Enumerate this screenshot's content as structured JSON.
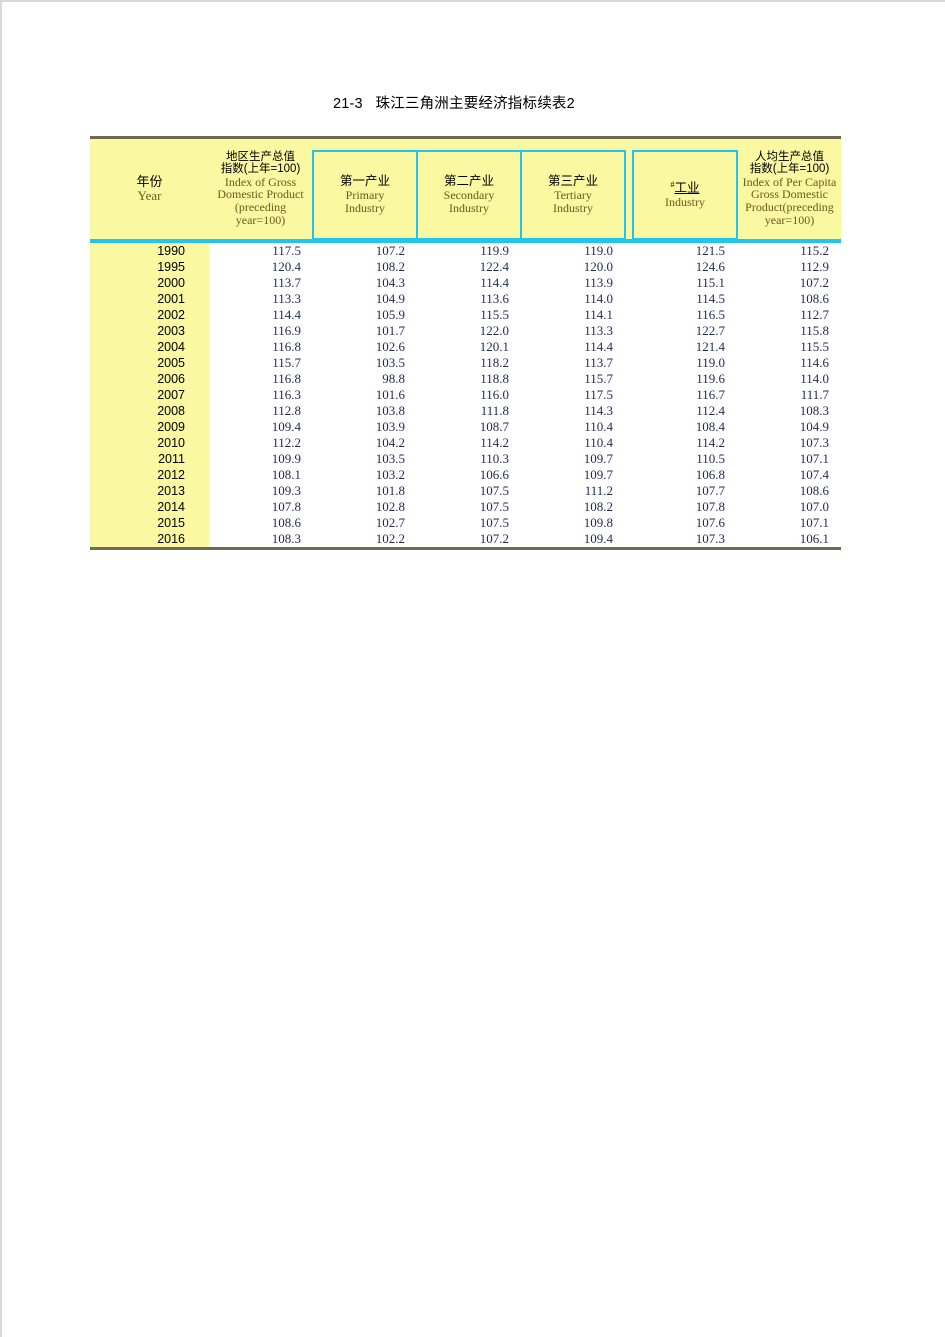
{
  "title": "21-3   珠江三角洲主要经济指标续表2",
  "header": {
    "year": {
      "cn": "年份",
      "en": "Year"
    },
    "gdp_index": {
      "cn_line1": "地区生产总值",
      "cn_line2": "指数(上年=100)",
      "en_line1": "Index  of  Gross",
      "en_line2": "Domestic  Product",
      "en_line3": "(preceding",
      "en_line4": "year=100)"
    },
    "primary": {
      "cn": "第一产业",
      "en_line1": "Primary",
      "en_line2": "Industry"
    },
    "secondary": {
      "cn": "第二产业",
      "en_line1": "Secondary",
      "en_line2": "Industry"
    },
    "tertiary": {
      "cn": "第三产业",
      "en_line1": "Tertiary",
      "en_line2": "Industry"
    },
    "industry": {
      "mark": "#",
      "cn": "工业",
      "en": "Industry"
    },
    "per_capita_index": {
      "cn_line1": "人均生产总值",
      "cn_line2": "指数(上年=100)",
      "en_line1": "Index  of  Per  Capita",
      "en_line2": "Gross  Domestic",
      "en_line3": "Product(preceding",
      "en_line4": "year=100)"
    }
  },
  "colors": {
    "header_fill": "#faf8a0",
    "inner_border": "#23c4ef",
    "outer_rule": "#6e6a52",
    "cn_text": "#000000",
    "en_text": "#6b5a1e",
    "data_text": "#1f2a54"
  },
  "chart_data": {
    "type": "table",
    "title": "21-3   珠江三角洲主要经济指标续表2",
    "columns": [
      "年份 Year",
      "地区生产总值指数(上年=100) Index of Gross Domestic Product (preceding year=100)",
      "第一产业 Primary Industry",
      "第二产业 Secondary Industry",
      "第三产业 Tertiary Industry",
      "#工业 Industry",
      "人均生产总值指数(上年=100) Index of Per Capita Gross Domestic Product(preceding year=100)"
    ],
    "rows": [
      [
        "1990",
        "117.5",
        "107.2",
        "119.9",
        "119.0",
        "121.5",
        "115.2"
      ],
      [
        "1995",
        "120.4",
        "108.2",
        "122.4",
        "120.0",
        "124.6",
        "112.9"
      ],
      [
        "2000",
        "113.7",
        "104.3",
        "114.4",
        "113.9",
        "115.1",
        "107.2"
      ],
      [
        "2001",
        "113.3",
        "104.9",
        "113.6",
        "114.0",
        "114.5",
        "108.6"
      ],
      [
        "2002",
        "114.4",
        "105.9",
        "115.5",
        "114.1",
        "116.5",
        "112.7"
      ],
      [
        "2003",
        "116.9",
        "101.7",
        "122.0",
        "113.3",
        "122.7",
        "115.8"
      ],
      [
        "2004",
        "116.8",
        "102.6",
        "120.1",
        "114.4",
        "121.4",
        "115.5"
      ],
      [
        "2005",
        "115.7",
        "103.5",
        "118.2",
        "113.7",
        "119.0",
        "114.6"
      ],
      [
        "2006",
        "116.8",
        "98.8",
        "118.8",
        "115.7",
        "119.6",
        "114.0"
      ],
      [
        "2007",
        "116.3",
        "101.6",
        "116.0",
        "117.5",
        "116.7",
        "111.7"
      ],
      [
        "2008",
        "112.8",
        "103.8",
        "111.8",
        "114.3",
        "112.4",
        "108.3"
      ],
      [
        "2009",
        "109.4",
        "103.9",
        "108.7",
        "110.4",
        "108.4",
        "104.9"
      ],
      [
        "2010",
        "112.2",
        "104.2",
        "114.2",
        "110.4",
        "114.2",
        "107.3"
      ],
      [
        "2011",
        "109.9",
        "103.5",
        "110.3",
        "109.7",
        "110.5",
        "107.1"
      ],
      [
        "2012",
        "108.1",
        "103.2",
        "106.6",
        "109.7",
        "106.8",
        "107.4"
      ],
      [
        "2013",
        "109.3",
        "101.8",
        "107.5",
        "111.2",
        "107.7",
        "108.6"
      ],
      [
        "2014",
        "107.8",
        "102.8",
        "107.5",
        "108.2",
        "107.8",
        "107.0"
      ],
      [
        "2015",
        "108.6",
        "102.7",
        "107.5",
        "109.8",
        "107.6",
        "107.1"
      ],
      [
        "2016",
        "108.3",
        "102.2",
        "107.2",
        "109.4",
        "107.3",
        "106.1"
      ]
    ]
  }
}
